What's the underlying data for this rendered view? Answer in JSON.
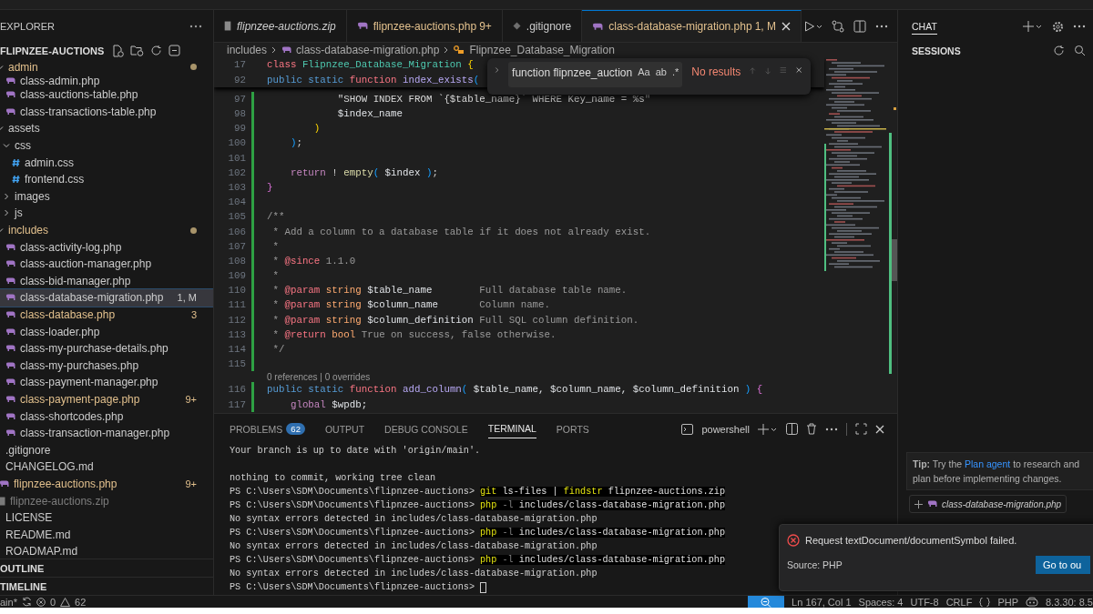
{
  "sidebar": {
    "title": "EXPLORER",
    "workspace": "FLIPNZEE-AUCTIONS",
    "tree": [
      {
        "name": "admin",
        "kind": "folder",
        "expanded": true,
        "warning": true,
        "ignored": false,
        "modified": true,
        "selected": false,
        "children": [
          {
            "name": "class-admin.php",
            "kind": "php",
            "warning": false,
            "ignored": false,
            "selected": false
          },
          {
            "name": "class-auctions-table.php",
            "kind": "php",
            "warning": false,
            "ignored": false,
            "selected": false
          },
          {
            "name": "class-transactions-table.php",
            "kind": "php",
            "warning": false,
            "ignored": false,
            "selected": false
          }
        ]
      },
      {
        "name": "assets",
        "kind": "folder",
        "expanded": true,
        "warning": false,
        "ignored": false,
        "modified": false,
        "selected": false,
        "children": [
          {
            "name": "css",
            "kind": "folder",
            "expanded": true,
            "warning": false,
            "ignored": false,
            "modified": false,
            "selected": false,
            "children": [
              {
                "name": "admin.css",
                "kind": "css",
                "warning": false,
                "ignored": false,
                "selected": false
              },
              {
                "name": "frontend.css",
                "kind": "css",
                "warning": false,
                "ignored": false,
                "selected": false
              }
            ]
          },
          {
            "name": "images",
            "kind": "folder",
            "expanded": false,
            "warning": false,
            "ignored": false,
            "modified": false,
            "selected": false
          },
          {
            "name": "js",
            "kind": "folder",
            "expanded": false,
            "warning": false,
            "ignored": false,
            "modified": false,
            "selected": false
          }
        ]
      },
      {
        "name": "includes",
        "kind": "folder",
        "expanded": true,
        "warning": true,
        "ignored": false,
        "modified": true,
        "selected": false,
        "children": [
          {
            "name": "class-activity-log.php",
            "kind": "php",
            "warning": false,
            "ignored": false,
            "selected": false
          },
          {
            "name": "class-auction-manager.php",
            "kind": "php",
            "warning": false,
            "ignored": false,
            "selected": false
          },
          {
            "name": "class-bid-manager.php",
            "kind": "php",
            "warning": false,
            "ignored": false,
            "selected": false
          },
          {
            "name": "class-database-migration.php",
            "kind": "php",
            "warning": false,
            "ignored": false,
            "badge": "1, M",
            "selected": true
          },
          {
            "name": "class-database.php",
            "kind": "php",
            "warning": true,
            "ignored": false,
            "badge": "3",
            "selected": false
          },
          {
            "name": "class-loader.php",
            "kind": "php",
            "warning": false,
            "ignored": false,
            "selected": false
          },
          {
            "name": "class-my-purchase-details.php",
            "kind": "php",
            "warning": false,
            "ignored": false,
            "selected": false
          },
          {
            "name": "class-my-purchases.php",
            "kind": "php",
            "warning": false,
            "ignored": false,
            "selected": false
          },
          {
            "name": "class-payment-manager.php",
            "kind": "php",
            "warning": false,
            "ignored": false,
            "selected": false
          },
          {
            "name": "class-payment-page.php",
            "kind": "php",
            "warning": true,
            "ignored": false,
            "badge": "9+",
            "selected": false
          },
          {
            "name": "class-shortcodes.php",
            "kind": "php",
            "warning": false,
            "ignored": false,
            "selected": false
          },
          {
            "name": "class-transaction-manager.php",
            "kind": "php",
            "warning": false,
            "ignored": false,
            "selected": false
          }
        ]
      },
      {
        "name": ".gitignore",
        "kind": "file",
        "warning": false,
        "ignored": false,
        "selected": false
      },
      {
        "name": "CHANGELOG.md",
        "kind": "file",
        "warning": false,
        "ignored": false,
        "selected": false
      },
      {
        "name": "flipnzee-auctions.php",
        "kind": "php",
        "warning": true,
        "ignored": false,
        "badge": "9+",
        "selected": false
      },
      {
        "name": "flipnzee-auctions.zip",
        "kind": "zip",
        "warning": false,
        "ignored": true,
        "selected": false
      },
      {
        "name": "LICENSE",
        "kind": "file",
        "warning": false,
        "ignored": false,
        "selected": false
      },
      {
        "name": "README.md",
        "kind": "file",
        "warning": false,
        "ignored": false,
        "selected": false
      },
      {
        "name": "ROADMAP.md",
        "kind": "file",
        "warning": false,
        "ignored": false,
        "selected": false
      }
    ],
    "sections": [
      "OUTLINE",
      "TIMELINE"
    ]
  },
  "editor": {
    "tabs": [
      {
        "label": "flipnzee-auctions.zip",
        "kind": "zip",
        "preview": true,
        "warning": false,
        "selected": false
      },
      {
        "label": "flipnzee-auctions.php",
        "badge": "9+",
        "kind": "php",
        "preview": false,
        "warning": true,
        "selected": false
      },
      {
        "label": ".gitignore",
        "kind": "git",
        "preview": false,
        "warning": false,
        "selected": false
      },
      {
        "label": "class-database-migration.php",
        "badge": "1, M",
        "kind": "php",
        "preview": false,
        "warning": true,
        "selected": true
      }
    ],
    "breadcrumbs": [
      "includes",
      "class-database-migration.php",
      "Flipnzee_Database_Migration"
    ],
    "lines": [
      {
        "kind": "code",
        "number": "17",
        "sticky": true,
        "changed": false,
        "tokens": [
          {
            "text": "class ",
            "kind": "kw2"
          },
          {
            "text": "Flipnzee_Database_Migration ",
            "kind": "cls"
          },
          {
            "text": "{",
            "kind": "brace"
          }
        ]
      },
      {
        "kind": "code",
        "number": "92",
        "sticky": true,
        "changed": false,
        "tokens": [
          {
            "text": "public static ",
            "kind": "kw"
          },
          {
            "text": "function ",
            "kind": "kw2"
          },
          {
            "text": "index_exists",
            "kind": "fn"
          },
          {
            "text": "(",
            "kind": "paren"
          }
        ]
      },
      {
        "kind": "code",
        "number": "97",
        "sticky": false,
        "changed": true,
        "tokens": [
          {
            "text": "            \"SHOW INDEX FROM `{$table_name}` WHERE Key_name = %s\"",
            "kind": "str"
          }
        ]
      },
      {
        "kind": "code",
        "number": "98",
        "sticky": false,
        "changed": true,
        "tokens": [
          {
            "text": "            $index_name",
            "kind": "var"
          }
        ]
      },
      {
        "kind": "code",
        "number": "99",
        "sticky": false,
        "changed": true,
        "tokens": [
          {
            "text": "        )",
            "kind": "brace"
          }
        ]
      },
      {
        "kind": "code",
        "number": "100",
        "sticky": false,
        "changed": true,
        "tokens": [
          {
            "text": "    )",
            "kind": "paren"
          },
          {
            "text": ";",
            "kind": "pl"
          }
        ]
      },
      {
        "kind": "code",
        "number": "101",
        "sticky": false,
        "changed": true
      },
      {
        "kind": "code",
        "number": "102",
        "sticky": false,
        "changed": true,
        "tokens": [
          {
            "text": "    return",
            "kind": "ctl"
          },
          {
            "text": " ! ",
            "kind": "pl"
          },
          {
            "text": "empty",
            "kind": "fnc"
          },
          {
            "text": "(",
            "kind": "paren"
          },
          {
            "text": " $index ",
            "kind": "var"
          },
          {
            "text": ")",
            "kind": "paren"
          },
          {
            "text": ";",
            "kind": "pl"
          }
        ]
      },
      {
        "kind": "code",
        "number": "103",
        "sticky": false,
        "changed": true,
        "tokens": [
          {
            "text": "}",
            "kind": "paren2"
          }
        ]
      },
      {
        "kind": "code",
        "number": "104",
        "sticky": false,
        "changed": true
      },
      {
        "kind": "code",
        "number": "105",
        "sticky": false,
        "changed": true,
        "tokens": [
          {
            "text": "/**",
            "kind": "cm"
          }
        ]
      },
      {
        "kind": "code",
        "number": "106",
        "sticky": false,
        "changed": true,
        "tokens": [
          {
            "text": " * Add a column to a database table if it does not already exist.",
            "kind": "cm"
          }
        ]
      },
      {
        "kind": "code",
        "number": "107",
        "sticky": false,
        "changed": true,
        "tokens": [
          {
            "text": " *",
            "kind": "cm"
          }
        ]
      },
      {
        "kind": "code",
        "number": "108",
        "sticky": false,
        "changed": true,
        "tokens": [
          {
            "text": " * ",
            "kind": "cm"
          },
          {
            "text": "@since",
            "kind": "tag"
          },
          {
            "text": " 1.1.0",
            "kind": "cm"
          }
        ]
      },
      {
        "kind": "code",
        "number": "109",
        "sticky": false,
        "changed": true,
        "tokens": [
          {
            "text": " *",
            "kind": "cm"
          }
        ]
      },
      {
        "kind": "code",
        "number": "110",
        "sticky": false,
        "changed": true,
        "tokens": [
          {
            "text": " * ",
            "kind": "cm"
          },
          {
            "text": "@param ",
            "kind": "tag"
          },
          {
            "text": "string",
            "kind": "type"
          },
          {
            "text": " $table_name",
            "kind": "var"
          },
          {
            "text": "        Full database table name.",
            "kind": "cm"
          }
        ]
      },
      {
        "kind": "code",
        "number": "111",
        "sticky": false,
        "changed": true,
        "tokens": [
          {
            "text": " * ",
            "kind": "cm"
          },
          {
            "text": "@param ",
            "kind": "tag"
          },
          {
            "text": "string",
            "kind": "type"
          },
          {
            "text": " $column_name",
            "kind": "var"
          },
          {
            "text": "       Column name.",
            "kind": "cm"
          }
        ]
      },
      {
        "kind": "code",
        "number": "112",
        "sticky": false,
        "changed": true,
        "tokens": [
          {
            "text": " * ",
            "kind": "cm"
          },
          {
            "text": "@param ",
            "kind": "tag"
          },
          {
            "text": "string",
            "kind": "type"
          },
          {
            "text": " $column_definition",
            "kind": "var"
          },
          {
            "text": " Full SQL column definition.",
            "kind": "cm"
          }
        ]
      },
      {
        "kind": "code",
        "number": "113",
        "sticky": false,
        "changed": true,
        "tokens": [
          {
            "text": " * ",
            "kind": "cm"
          },
          {
            "text": "@return ",
            "kind": "tag"
          },
          {
            "text": "bool",
            "kind": "type"
          },
          {
            "text": " True on success, false otherwise.",
            "kind": "cm"
          }
        ]
      },
      {
        "kind": "code",
        "number": "114",
        "sticky": false,
        "changed": true,
        "tokens": [
          {
            "text": " */",
            "kind": "cm"
          }
        ]
      },
      {
        "kind": "code",
        "number": "115",
        "sticky": false,
        "changed": true
      },
      {
        "kind": "codelens",
        "text": "0 references | 0 overrides"
      },
      {
        "kind": "code",
        "number": "116",
        "sticky": false,
        "changed": true,
        "tokens": [
          {
            "text": "public static ",
            "kind": "kw"
          },
          {
            "text": "function ",
            "kind": "kw2"
          },
          {
            "text": "add_column",
            "kind": "fn"
          },
          {
            "text": "(",
            "kind": "paren"
          },
          {
            "text": " $table_name, $column_name, $column_definition ",
            "kind": "var"
          },
          {
            "text": ")",
            "kind": "paren"
          },
          {
            "text": " {",
            "kind": "paren2"
          }
        ]
      },
      {
        "kind": "code",
        "number": "117",
        "sticky": false,
        "changed": true,
        "tokens": [
          {
            "text": "    global",
            "kind": "ctl"
          },
          {
            "text": " $wpdb;",
            "kind": "var"
          }
        ]
      }
    ],
    "find": {
      "query": "function flipnzee_auction",
      "options": [
        "Aa",
        "ab",
        ".*"
      ],
      "result": "No results"
    }
  },
  "panel": {
    "tabs": [
      {
        "label": "PROBLEMS",
        "badge": "62",
        "selected": false
      },
      {
        "label": "OUTPUT",
        "selected": false
      },
      {
        "label": "DEBUG CONSOLE",
        "selected": false
      },
      {
        "label": "TERMINAL",
        "selected": true
      },
      {
        "label": "PORTS",
        "selected": false
      }
    ],
    "shell": "powershell",
    "terminal": [
      {
        "kind": "output",
        "text": "Your branch is up to date with 'origin/main'."
      },
      {
        "kind": "blank"
      },
      {
        "kind": "output",
        "text": "nothing to commit, working tree clean"
      },
      {
        "kind": "prompt",
        "prompt": "PS C:\\Users\\SDM\\Documents\\flipnzee-auctions>",
        "command": [
          {
            "text": "git",
            "kind": "cmd"
          },
          {
            "text": " ls-files | ",
            "kind": "arg"
          },
          {
            "text": "findstr",
            "kind": "cmd"
          },
          {
            "text": " flipnzee-auctions.zip",
            "kind": "arg"
          }
        ]
      },
      {
        "kind": "prompt",
        "prompt": "PS C:\\Users\\SDM\\Documents\\flipnzee-auctions>",
        "command": [
          {
            "text": "php",
            "kind": "cmd"
          },
          {
            "text": " -l",
            "kind": "flag"
          },
          {
            "text": " includes/class-database-migration.php",
            "kind": "arg"
          }
        ]
      },
      {
        "kind": "output",
        "text": "No syntax errors detected in includes/class-database-migration.php"
      },
      {
        "kind": "prompt",
        "prompt": "PS C:\\Users\\SDM\\Documents\\flipnzee-auctions>",
        "command": [
          {
            "text": "php",
            "kind": "cmd"
          },
          {
            "text": " -l",
            "kind": "flag"
          },
          {
            "text": " includes/class-database-migration.php",
            "kind": "arg"
          }
        ]
      },
      {
        "kind": "output",
        "text": "No syntax errors detected in includes/class-database-migration.php"
      },
      {
        "kind": "prompt",
        "prompt": "PS C:\\Users\\SDM\\Documents\\flipnzee-auctions>",
        "command": [
          {
            "text": "php",
            "kind": "cmd"
          },
          {
            "text": " -l",
            "kind": "flag"
          },
          {
            "text": " includes/class-database-migration.php",
            "kind": "arg"
          }
        ]
      },
      {
        "kind": "output",
        "text": "No syntax errors detected in includes/class-database-migration.php"
      },
      {
        "kind": "prompt",
        "prompt": "PS C:\\Users\\SDM\\Documents\\flipnzee-auctions>",
        "cursor": true
      }
    ]
  },
  "chat": {
    "tab": "CHAT",
    "section": "SESSIONS",
    "tip": {
      "before": "**Tip:** Try the ",
      "link": "Plan agent",
      "after": " to research and plan before implementing changes."
    },
    "context_file": "class-database-migration.php"
  },
  "notification": {
    "message": "Request textDocument/documentSymbol failed.",
    "source": "Source: PHP",
    "button": "Go to ou"
  },
  "status_bar": {
    "branch": "ain*",
    "errors": "0",
    "warnings": "62",
    "right": [
      {
        "text": "Ln 167, Col 1",
        "kind": "text"
      },
      {
        "text": "Spaces: 4",
        "kind": "text"
      },
      {
        "text": "UTF-8",
        "kind": "text"
      },
      {
        "text": "CRLF",
        "kind": "text"
      },
      {
        "text": "PHP",
        "kind": "language"
      },
      {
        "text": "8.3.30: 8.5",
        "kind": "version"
      }
    ]
  }
}
